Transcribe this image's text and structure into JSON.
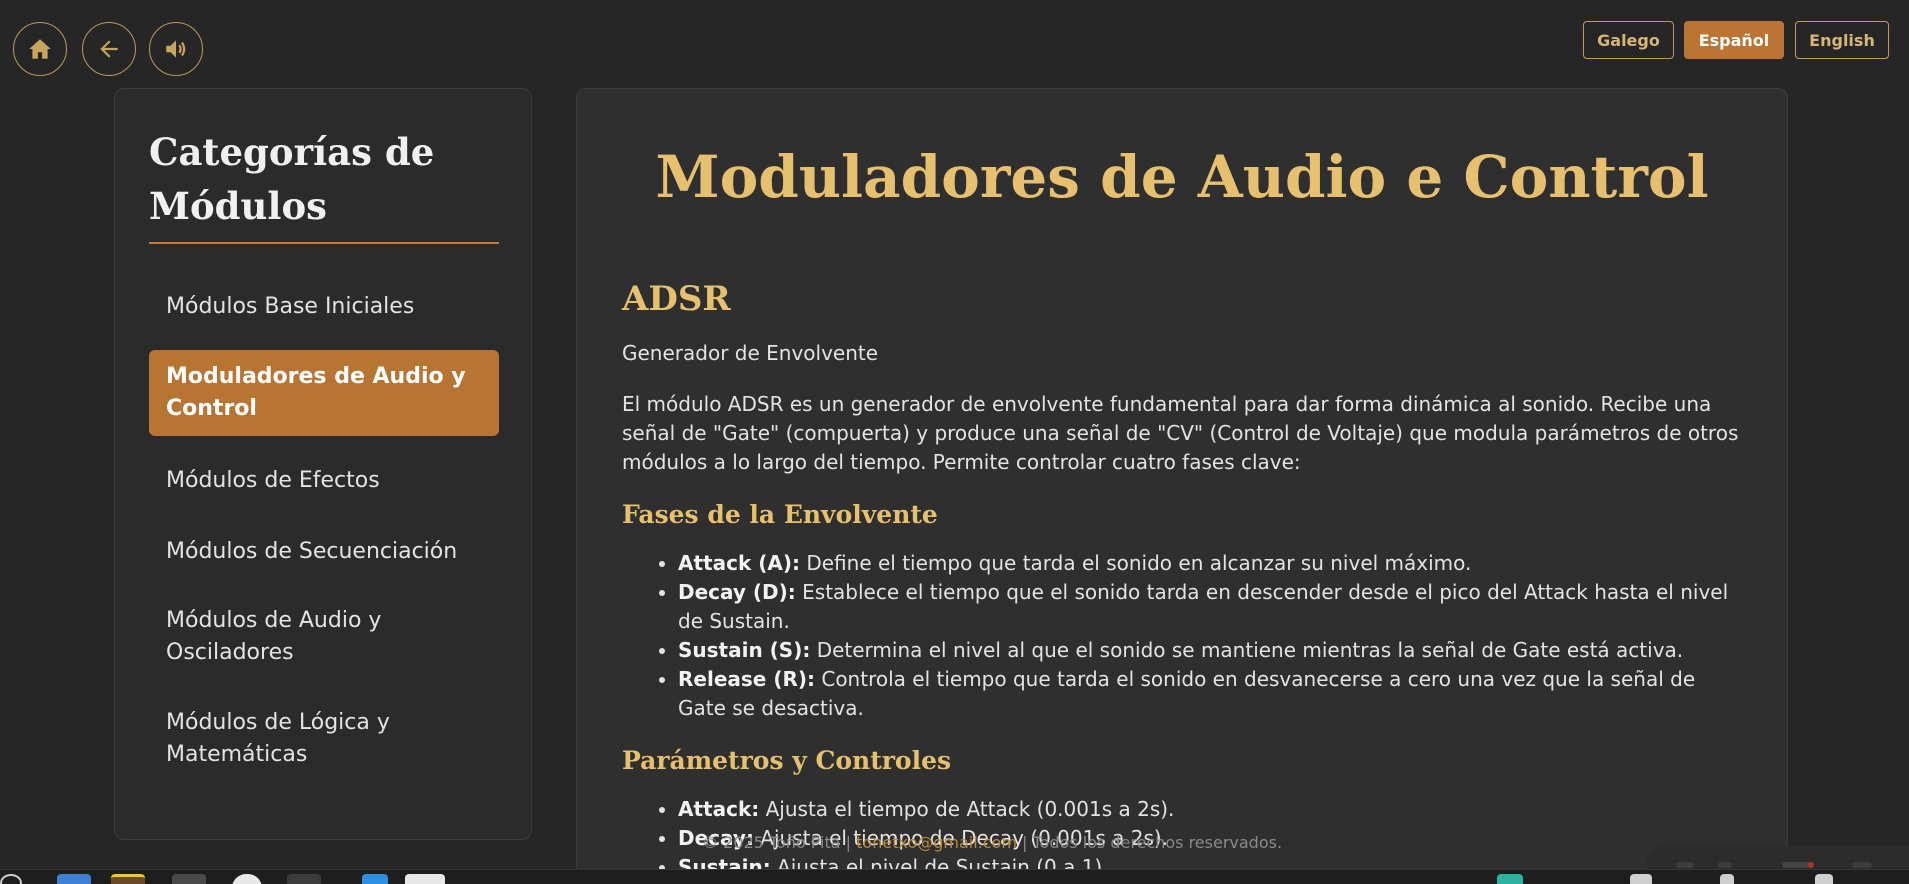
{
  "toolbar": {
    "home_icon": "home-icon",
    "back_icon": "arrow-left-icon",
    "audio_icon": "speaker-icon"
  },
  "languages": {
    "galego": "Galego",
    "espanol": "Español",
    "english": "English",
    "active": "Español"
  },
  "sidebar": {
    "title": "Categorías de Módulos",
    "items": [
      {
        "label": "Módulos Base Iniciales",
        "active": false
      },
      {
        "label": "Moduladores de Audio y Control",
        "active": true
      },
      {
        "label": "Módulos de Efectos",
        "active": false
      },
      {
        "label": "Módulos de Secuenciación",
        "active": false
      },
      {
        "label": "Módulos de Audio y Osciladores",
        "active": false
      },
      {
        "label": "Módulos de Lógica y Matemáticas",
        "active": false
      }
    ]
  },
  "main": {
    "title": "Moduladores de Audio e Control",
    "module": {
      "name": "ADSR",
      "subtitle": "Generador de Envolvente",
      "description": "El módulo ADSR es un generador de envolvente fundamental para dar forma dinámica al sonido. Recibe una señal de \"Gate\" (compuerta) y produce una señal de \"CV\" (Control de Voltaje) que modula parámetros de otros módulos a lo largo del tiempo. Permite controlar cuatro fases clave:",
      "phases_title": "Fases de la Envolvente",
      "phases": [
        {
          "term": "Attack (A):",
          "text": " Define el tiempo que tarda el sonido en alcanzar su nivel máximo."
        },
        {
          "term": "Decay (D):",
          "text": " Establece el tiempo que el sonido tarda en descender desde el pico del Attack hasta el nivel de Sustain."
        },
        {
          "term": "Sustain (S):",
          "text": " Determina el nivel al que el sonido se mantiene mientras la señal de Gate está activa."
        },
        {
          "term": "Release (R):",
          "text": " Controla el tiempo que tarda el sonido en desvanecerse a cero una vez que la señal de Gate se desactiva."
        }
      ],
      "params_title": "Parámetros y Controles",
      "params": [
        {
          "term": "Attack:",
          "text": " Ajusta el tiempo de Attack (0.001s a 2s)."
        },
        {
          "term": "Decay:",
          "text": " Ajusta el tiempo de Decay (0.001s a 2s)."
        },
        {
          "term": "Sustain:",
          "text": " Ajusta el nivel de Sustain (0 a 1)."
        }
      ]
    }
  },
  "footer": {
    "prefix": "© 2025 Toño Pita | ",
    "email": "tonetxo@gmail.com",
    "suffix": " | Todos los derechos reservados."
  },
  "colors": {
    "accent": "#bb7433",
    "gold": "#e6c06f",
    "background": "#262626",
    "panel": "#2f2f2f"
  }
}
